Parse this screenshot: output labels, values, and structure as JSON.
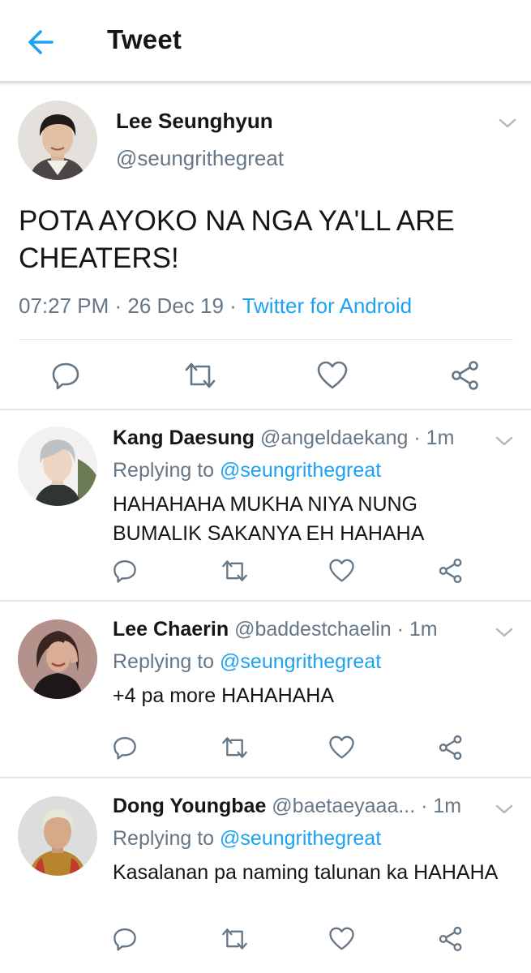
{
  "header": {
    "title": "Tweet",
    "accent_color": "#1da1f2"
  },
  "main_tweet": {
    "author_name": "Lee Seunghyun",
    "author_handle": "@seungrithegreat",
    "text": "POTA AYOKO NA NGA YA'LL ARE CHEATERS!",
    "time": "07:27 PM · 26 Dec 19 · ",
    "source": "Twitter for Android"
  },
  "replies": [
    {
      "name": "Kang Daesung",
      "handle": "@angeldaekang · 1m",
      "replying_prefix": "Replying to ",
      "replying_to": "@seungrithegreat",
      "text": "HAHAHAHA MUKHA NIYA NUNG BUMALIK SAKANYA EH HAHAHA"
    },
    {
      "name": "Lee Chaerin",
      "handle": "@baddestchaelin · 1m",
      "replying_prefix": "Replying to ",
      "replying_to": "@seungrithegreat",
      "text": "+4 pa more HAHAHAHA"
    },
    {
      "name": "Dong Youngbae",
      "handle": "@baetaeyaaa... · 1m",
      "replying_prefix": "Replying to ",
      "replying_to": "@seungrithegreat",
      "text": "Kasalanan pa naming talunan ka HAHAHA"
    }
  ],
  "icons": {
    "back": "arrow-left-icon",
    "menu": "chevron-down-icon",
    "reply": "reply-bubble-icon",
    "retweet": "retweet-icon",
    "like": "heart-icon",
    "share": "share-icon"
  },
  "colors": {
    "text_primary": "#14171a",
    "text_secondary": "#657786",
    "divider": "#e1e8ed",
    "link": "#1da1f2"
  }
}
